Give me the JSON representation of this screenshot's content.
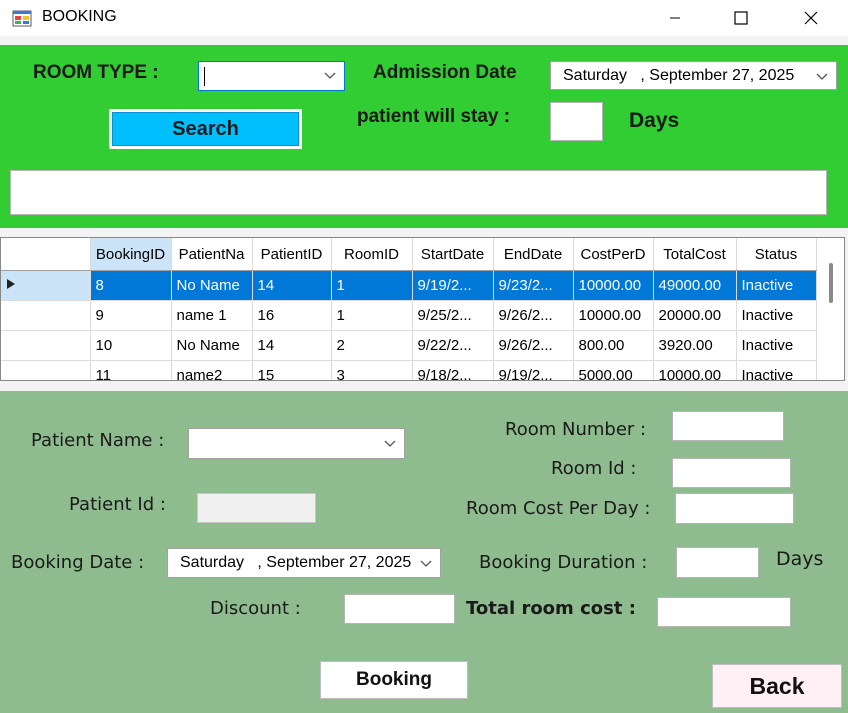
{
  "window": {
    "title": "BOOKING",
    "icon": "app-window-icon"
  },
  "search_panel": {
    "room_type_label": "ROOM TYPE :",
    "room_type_value": "",
    "admission_date_label": "Admission Date",
    "admission_date_value": "Saturday   , September 27, 2025",
    "stay_label": "patient will stay :",
    "stay_value": "",
    "days_label": "Days",
    "search_button": "Search",
    "result_text": ""
  },
  "grid": {
    "columns": [
      "BookingID",
      "PatientNa",
      "PatientID",
      "RoomID",
      "StartDate",
      "EndDate",
      "CostPerD",
      "TotalCost",
      "Status"
    ],
    "rows": [
      [
        "8",
        "No Name",
        "14",
        "1",
        "9/19/2...",
        "9/23/2...",
        "10000.00",
        "49000.00",
        "Inactive"
      ],
      [
        "9",
        "name 1",
        "16",
        "1",
        "9/25/2...",
        "9/26/2...",
        "10000.00",
        "20000.00",
        "Inactive"
      ],
      [
        "10",
        "No Name",
        "14",
        "2",
        "9/22/2...",
        "9/26/2...",
        "800.00",
        "3920.00",
        "Inactive"
      ],
      [
        "11",
        "name2",
        "15",
        "3",
        "9/18/2...",
        "9/19/2...",
        "5000.00",
        "10000.00",
        "Inactive"
      ]
    ],
    "selected_row": 0
  },
  "form": {
    "patient_name_label": "Patient Name :",
    "patient_name_value": "",
    "patient_id_label": "Patient Id :",
    "patient_id_value": "",
    "room_number_label": "Room Number :",
    "room_number_value": "",
    "room_id_label": "Room Id :",
    "room_id_value": "",
    "room_cost_label": "Room Cost Per Day :",
    "room_cost_value": "",
    "booking_date_label": "Booking Date :",
    "booking_date_value": "Saturday   , September 27, 2025",
    "booking_duration_label": "Booking Duration :",
    "booking_duration_value": "",
    "days_label": "Days",
    "discount_label": "Discount :",
    "discount_value": "",
    "total_cost_label": "Total room cost :",
    "total_cost_value": "",
    "booking_button": "Booking",
    "back_button": "Back"
  },
  "colors": {
    "top_panel": "#32cd32",
    "bottom_panel": "#8fbc8f",
    "search_button": "#00bfff",
    "selection": "#0078d7",
    "back_button": "#fff0f5"
  }
}
